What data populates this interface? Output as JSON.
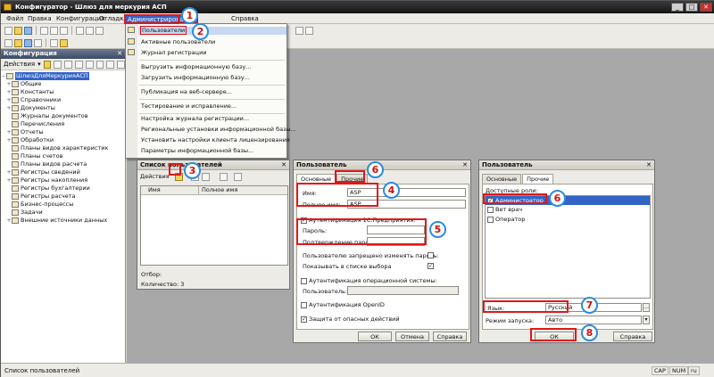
{
  "window": {
    "title": "Конфигуратор - Шлюз для меркурия АСП"
  },
  "menu": [
    "Файл",
    "Правка",
    "Конфигурация",
    "Отладка",
    "Администрирование",
    "Справка"
  ],
  "admin_menu": {
    "items": [
      "Пользователи",
      "Активные пользователи",
      "Журнал регистрации",
      "Выгрузить информационную базу...",
      "Загрузить информационную базу...",
      "Публикация на веб-сервере...",
      "Тестирование и исправление...",
      "Настройка журнала регистрации...",
      "Региональные установки информационной базы...",
      "Установить настройки клиента лицензирования",
      "Параметры информационной базы..."
    ]
  },
  "config_panel": {
    "title": "Конфигурация",
    "actions_label": "Действия",
    "root": "ШлюзДляМеркурияАСП",
    "nodes": [
      "Общие",
      "Константы",
      "Справочники",
      "Документы",
      "Журналы документов",
      "Перечисления",
      "Отчеты",
      "Обработки",
      "Планы видов характеристик",
      "Планы счетов",
      "Планы видов расчета",
      "Регистры сведений",
      "Регистры накопления",
      "Регистры бухгалтерии",
      "Регистры расчета",
      "Бизнес-процессы",
      "Задачи",
      "Внешние источники данных"
    ]
  },
  "users_list": {
    "title": "Список пользователей",
    "actions_label": "Действия",
    "col_name": "Имя",
    "col_fullname": "Полное имя",
    "filter_label": "Отбор:",
    "count_label": "Количество: 3"
  },
  "user_dialog_main": {
    "title": "Пользователь",
    "tabs": [
      "Основные",
      "Прочие"
    ],
    "name_label": "Имя:",
    "name_value": "ASP",
    "fullname_label": "Полное имя:",
    "fullname_value": "ASP",
    "auth1c_label": "Аутентификация 1С:Предприятия:",
    "password_label": "Пароль:",
    "password_confirm_label": "Подтверждение пароля:",
    "forbid_change_label": "Пользователю запрещено изменять пароль:",
    "show_in_list_label": "Показывать в списке выбора",
    "os_auth_label": "Аутентификация операционной системы:",
    "os_user_label": "Пользователь:",
    "openid_label": "Аутентификация OpenID",
    "danger_label": "Защита от опасных действий",
    "ok": "ОК",
    "cancel": "Отмена",
    "help": "Справка"
  },
  "user_dialog_other": {
    "title": "Пользователь",
    "tabs": [
      "Основные",
      "Прочие"
    ],
    "roles_label": "Доступные роли:",
    "roles": [
      "Администратор",
      "Вет врач",
      "Оператор"
    ],
    "lang_label": "Язык:",
    "lang_value": "Русский",
    "mode_label": "Режим запуска:",
    "mode_value": "Авто",
    "ok": "ОК",
    "help": "Справка"
  },
  "badges": [
    "1",
    "2",
    "3",
    "4",
    "5",
    "6",
    "6",
    "7",
    "8"
  ],
  "status": {
    "text": "Список пользователей",
    "indicators": [
      "CAP",
      "NUM",
      "ru"
    ]
  },
  "colors": {
    "highlight": "#e01818",
    "badge_ring": "#2a8ce0",
    "selection": "#3264c8"
  }
}
